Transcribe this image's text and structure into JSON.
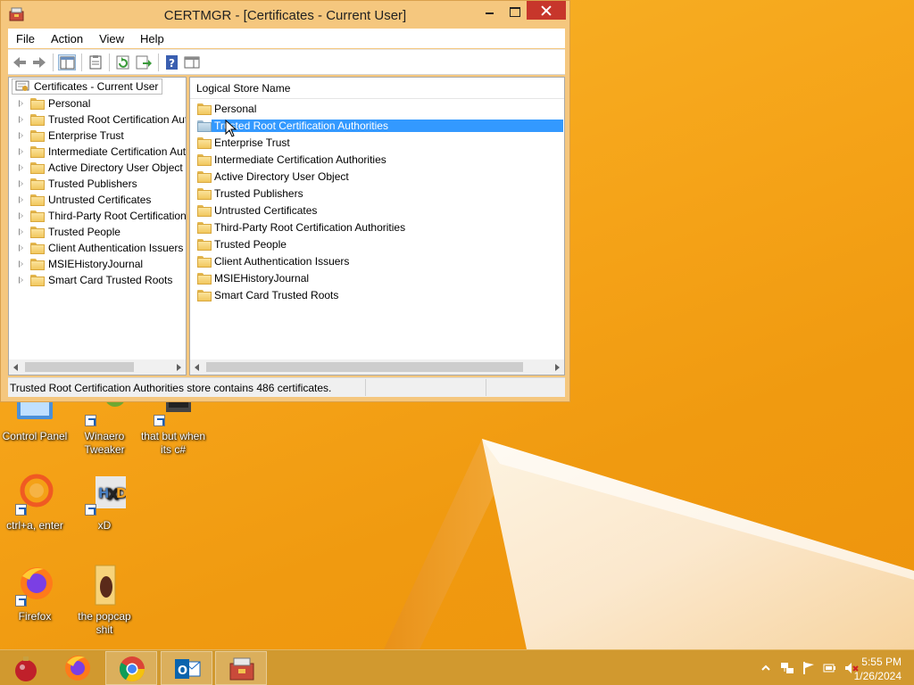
{
  "window": {
    "title": "CERTMGR - [Certificates - Current User]"
  },
  "menu": [
    "File",
    "Action",
    "View",
    "Help"
  ],
  "toolbar": {
    "icons": [
      "back-icon",
      "forward-icon",
      "show-tree-icon",
      "properties-icon",
      "refresh-icon",
      "export-list-icon",
      "help-icon",
      "action-pane-icon"
    ]
  },
  "tree": {
    "root": "Certificates - Current User",
    "items": [
      {
        "label": "Personal"
      },
      {
        "label": "Trusted Root Certification Authorities"
      },
      {
        "label": "Enterprise Trust"
      },
      {
        "label": "Intermediate Certification Authorities"
      },
      {
        "label": "Active Directory User Object"
      },
      {
        "label": "Trusted Publishers"
      },
      {
        "label": "Untrusted Certificates"
      },
      {
        "label": "Third-Party Root Certification Authorities"
      },
      {
        "label": "Trusted People"
      },
      {
        "label": "Client Authentication Issuers"
      },
      {
        "label": "MSIEHistoryJournal"
      },
      {
        "label": "Smart Card Trusted Roots"
      }
    ]
  },
  "list": {
    "column_header": "Logical Store Name",
    "selected_index": 1,
    "items": [
      {
        "label": "Personal"
      },
      {
        "label": "Trusted Root Certification Authorities"
      },
      {
        "label": "Enterprise Trust"
      },
      {
        "label": "Intermediate Certification Authorities"
      },
      {
        "label": "Active Directory User Object"
      },
      {
        "label": "Trusted Publishers"
      },
      {
        "label": "Untrusted Certificates"
      },
      {
        "label": "Third-Party Root Certification Authorities"
      },
      {
        "label": "Trusted People"
      },
      {
        "label": "Client Authentication Issuers"
      },
      {
        "label": "MSIEHistoryJournal"
      },
      {
        "label": "Smart Card Trusted Roots"
      }
    ]
  },
  "status": {
    "text": "Trusted Root Certification Authorities store contains 486 certificates."
  },
  "desktop_icons": [
    {
      "label": "Control Panel",
      "icon": "control-panel-icon"
    },
    {
      "label": "Winaero Tweaker",
      "icon": "winaero-tweaker-icon"
    },
    {
      "label": "that but when its c#",
      "icon": "terminal-shortcut-icon"
    },
    {
      "label": "ctrl+a, enter",
      "icon": "origin-icon"
    },
    {
      "label": "xD",
      "icon": "hxd-icon"
    },
    {
      "label": "Firefox",
      "icon": "firefox-icon"
    },
    {
      "label": "the popcap shit",
      "icon": "folder-icon"
    }
  ],
  "taskbar": {
    "apps": [
      "ornament-icon",
      "firefox-icon",
      "chrome-icon",
      "outlook-icon",
      "certmgr-icon"
    ],
    "active_app": "certmgr-icon",
    "tray_icons": [
      "show-hidden-icons-chevron",
      "network-icon",
      "action-center-flag-icon",
      "power-icon",
      "volume-muted-icon"
    ],
    "time": "5:55 PM",
    "date": "1/26/2024"
  },
  "colors": {
    "selection": "#3399ff",
    "close_button": "#c7362b",
    "desktop": "#f5a318",
    "taskbar": "#d1992f"
  }
}
